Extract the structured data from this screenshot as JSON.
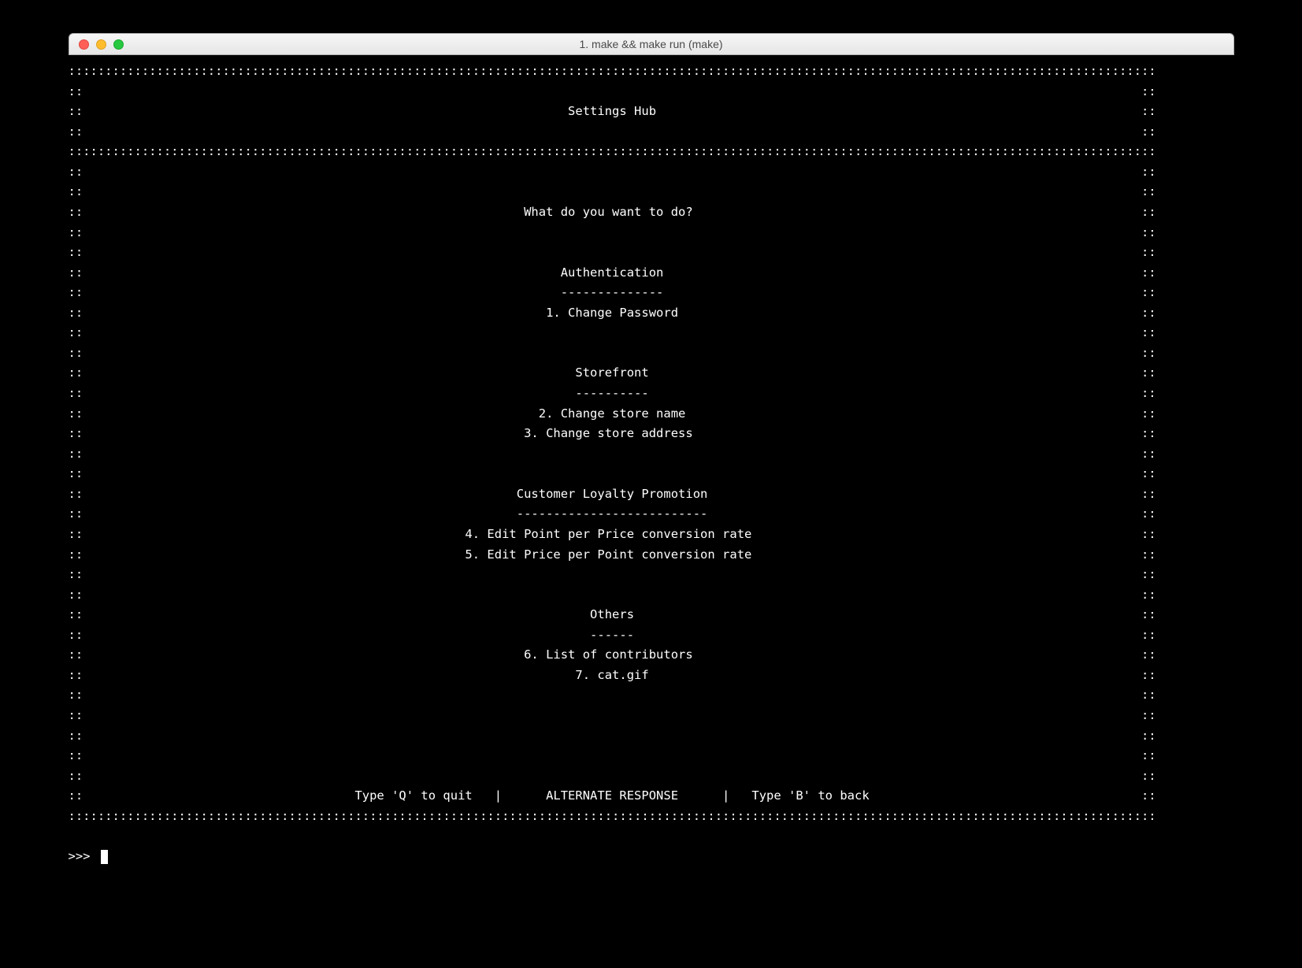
{
  "window": {
    "title": "1. make && make run (make)"
  },
  "header": {
    "title": "Settings Hub"
  },
  "prompt_question": "What do you want to do?",
  "sections": [
    {
      "title": "Authentication",
      "underline": "--------------",
      "items": [
        {
          "n": "1",
          "label": "Change Password"
        }
      ]
    },
    {
      "title": "Storefront",
      "underline": "----------",
      "items": [
        {
          "n": "2",
          "label": "Change store name"
        },
        {
          "n": "3",
          "label": "Change store address"
        }
      ]
    },
    {
      "title": "Customer Loyalty Promotion",
      "underline": "--------------------------",
      "items": [
        {
          "n": "4",
          "label": "Edit Point per Price conversion rate"
        },
        {
          "n": "5",
          "label": "Edit Price per Point conversion rate"
        }
      ]
    },
    {
      "title": "Others",
      "underline": "------",
      "items": [
        {
          "n": "6",
          "label": "List of contributors"
        },
        {
          "n": "7",
          "label": "cat.gif"
        }
      ]
    }
  ],
  "footer": {
    "quit": "Type 'Q' to quit",
    "middle": "ALTERNATE RESPONSE",
    "back": "Type 'B' to back",
    "sep": "|"
  },
  "input_prompt": ">>>"
}
